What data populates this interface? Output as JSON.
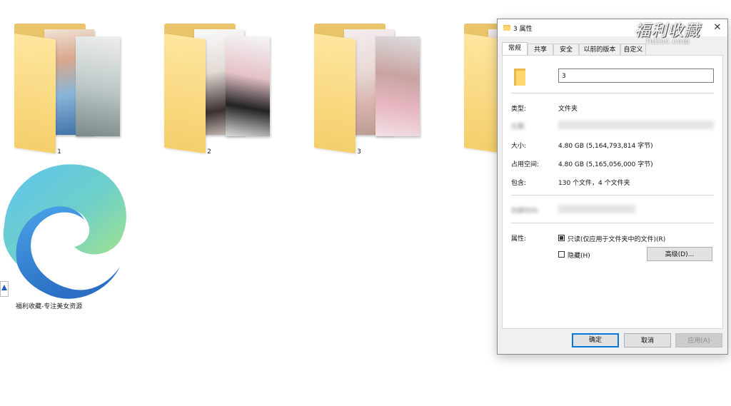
{
  "desktop": {
    "folders": [
      {
        "label": "1"
      },
      {
        "label": "2"
      },
      {
        "label": "3"
      }
    ],
    "shortcut": {
      "label": "福利收藏-专注美女资源",
      "icon": "edge-browser-icon"
    }
  },
  "dialog": {
    "title": "3 属性",
    "watermark": "福利收藏",
    "watermark_sub": "fulisc.com",
    "tabs": [
      {
        "label": "常规",
        "active": true
      },
      {
        "label": "共享"
      },
      {
        "label": "安全"
      },
      {
        "label": "以前的版本"
      },
      {
        "label": "自定义"
      }
    ],
    "name_value": "3",
    "type_label": "类型:",
    "type_value": "文件夹",
    "location_label": "位置:",
    "size_label": "大小:",
    "size_value": "4.80 GB (5,164,793,814 字节)",
    "disk_size_label": "占用空间:",
    "disk_size_value": "4.80 GB (5,165,056,000 字节)",
    "contains_label": "包含:",
    "contains_value": "130 个文件，4 个文件夹",
    "created_label": "创建时间:",
    "attributes_label": "属性:",
    "readonly_label": "只读(仅应用于文件夹中的文件)(R)",
    "readonly_checked": true,
    "hidden_label": "隐藏(H)",
    "hidden_checked": false,
    "advanced_button": "高级(D)...",
    "ok_button": "确定",
    "cancel_button": "取消",
    "apply_button": "应用(A)"
  },
  "colors": {
    "accent": "#0078d7",
    "folder": "#f4cf6b"
  }
}
